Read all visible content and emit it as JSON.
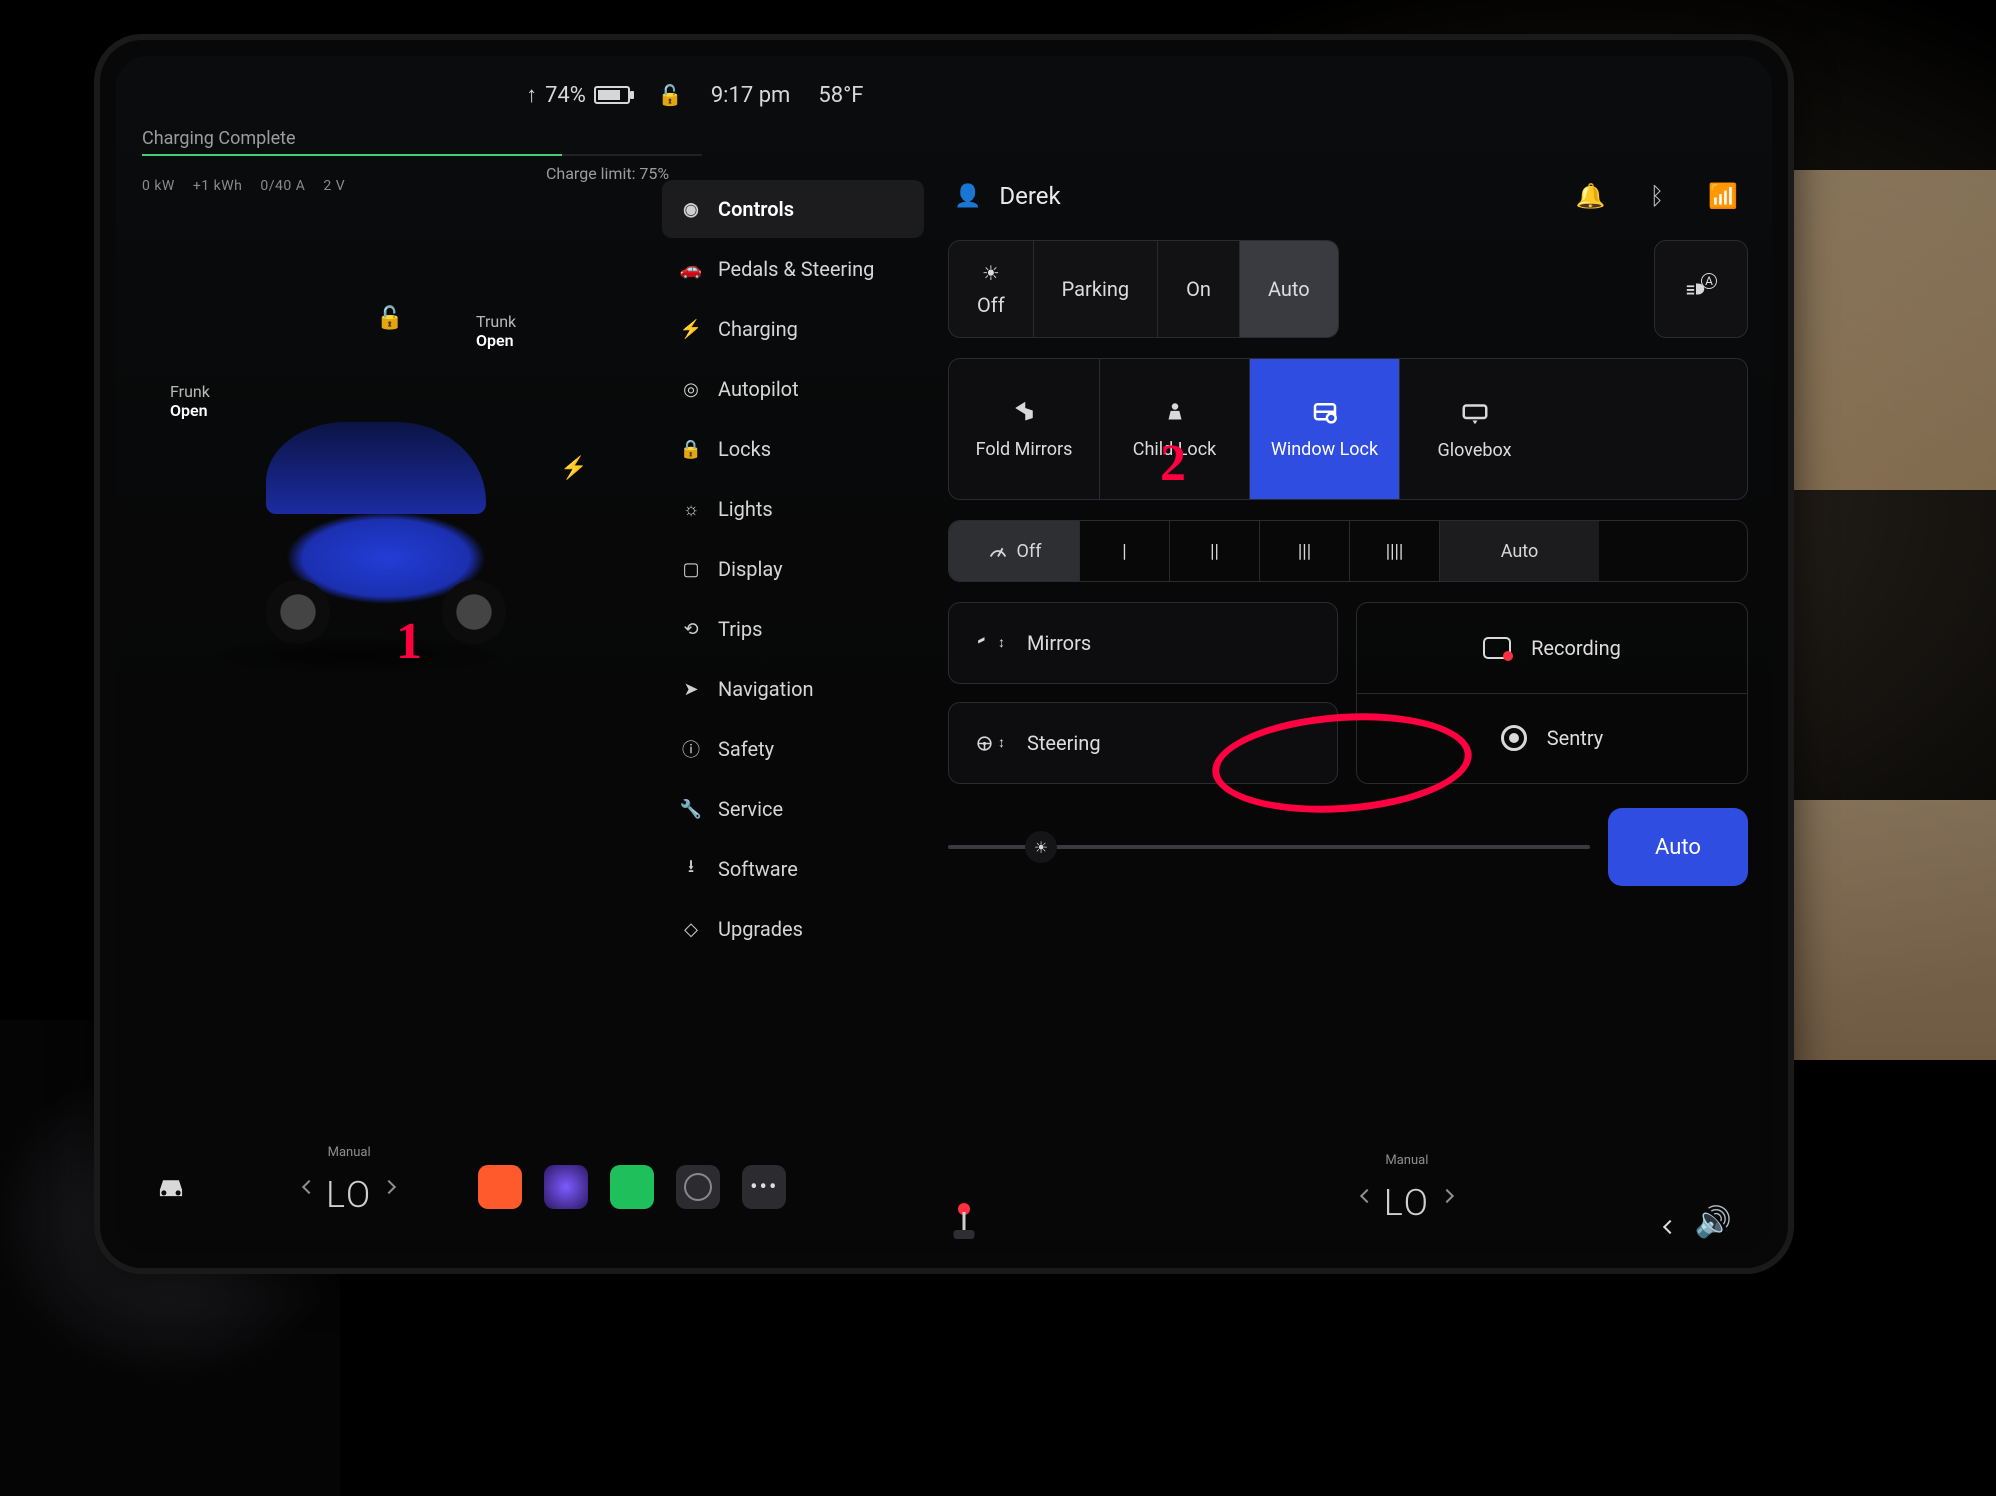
{
  "statusbar": {
    "battery_pct": "74%",
    "battery_arrow": "↑",
    "time": "9:17 pm",
    "temp": "58°F"
  },
  "charging": {
    "banner": "Charging Complete",
    "limit_label": "Charge limit: 75%",
    "stats": {
      "power": "0 kW",
      "added": "+1 kWh",
      "current": "0/40 A",
      "volts": "2 V"
    }
  },
  "carpanel": {
    "frunk_label": "Frunk",
    "frunk_state": "Open",
    "trunk_label": "Trunk",
    "trunk_state": "Open"
  },
  "sidebar": {
    "items": [
      {
        "id": "controls",
        "label": "Controls"
      },
      {
        "id": "pedals",
        "label": "Pedals & Steering"
      },
      {
        "id": "charging",
        "label": "Charging"
      },
      {
        "id": "autopilot",
        "label": "Autopilot"
      },
      {
        "id": "locks",
        "label": "Locks"
      },
      {
        "id": "lights",
        "label": "Lights"
      },
      {
        "id": "display",
        "label": "Display"
      },
      {
        "id": "trips",
        "label": "Trips"
      },
      {
        "id": "nav",
        "label": "Navigation"
      },
      {
        "id": "safety",
        "label": "Safety"
      },
      {
        "id": "service",
        "label": "Service"
      },
      {
        "id": "software",
        "label": "Software"
      },
      {
        "id": "upgrades",
        "label": "Upgrades"
      }
    ]
  },
  "header": {
    "profile": "Derek"
  },
  "lights_seg": {
    "off": "Off",
    "parking": "Parking",
    "on": "On",
    "auto": "Auto"
  },
  "tiles": {
    "fold": "Fold Mirrors",
    "child": "Child Lock",
    "window": "Window Lock",
    "glove": "Glovebox"
  },
  "wipers": {
    "off": "Off",
    "l1": "|",
    "l2": "||",
    "l3": "|||",
    "l4": "||||",
    "auto": "Auto"
  },
  "adjust": {
    "mirrors": "Mirrors",
    "steering": "Steering"
  },
  "recsentry": {
    "recording": "Recording",
    "sentry": "Sentry"
  },
  "brightness": {
    "auto": "Auto"
  },
  "annot": {
    "one": "1",
    "two": "2"
  },
  "dock": {
    "left_temp_mode": "Manual",
    "left_temp": "LO",
    "right_temp_mode": "Manual",
    "right_temp": "LO"
  }
}
